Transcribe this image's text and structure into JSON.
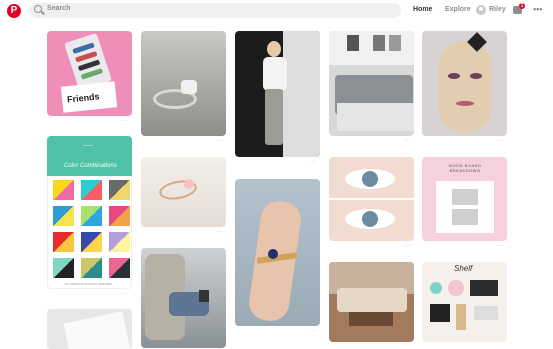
{
  "header": {
    "logo": "P",
    "search_placeholder": "Search",
    "nav": {
      "home": "Home",
      "explore": "Explore",
      "user": "Riley"
    },
    "notification_count": "1",
    "more": "•••"
  },
  "pins": {
    "friends": {
      "title": "Friends"
    },
    "colors": {
      "header_tag": "——",
      "title": "Color Combinations",
      "footer": "MY WEBSITE ARTICLE INSPIRED"
    },
    "moodboard": {
      "title": "MOOD BOARD BREAKDOWN"
    },
    "shelf": {
      "title": "Shelf"
    }
  },
  "more_glyph": "···"
}
